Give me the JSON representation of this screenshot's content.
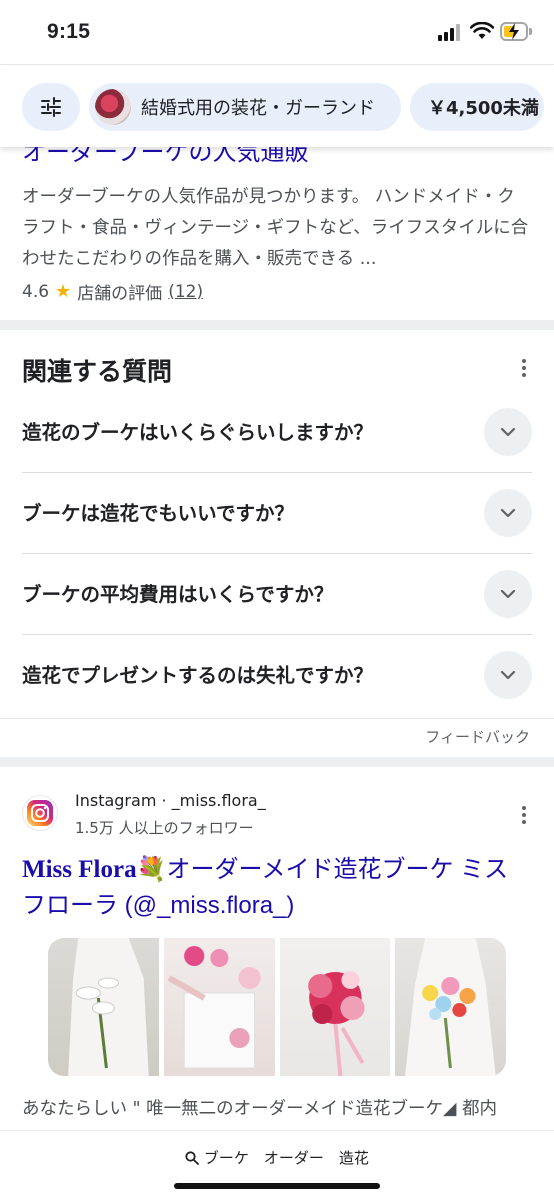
{
  "status_bar": {
    "time": "9:15"
  },
  "filter_chips": [
    {
      "label": ""
    },
    {
      "label": "結婚式用の装花・ガーランド"
    },
    {
      "label": "￥4,500未満"
    }
  ],
  "prev_result": {
    "title": "オーダーブーケの人気通販",
    "snippet": "オーダーブーケの人気作品が見つかります。 ハンドメイド・クラフト・食品・ヴィンテージ・ギフトなど、ライフスタイルに合わせたこだわりの作品を購入・販売できる ...",
    "rating_value": "4.6",
    "rating_label": "店舗の評価",
    "rating_count": "(12)"
  },
  "paa": {
    "heading": "関連する質問",
    "questions": [
      "造花のブーケはいくらぐらいしますか？",
      "ブーケは造花でもいいですか？",
      "ブーケの平均費用はいくらですか？",
      "造花でプレゼントするのは失礼ですか？"
    ],
    "feedback": "フィードバック"
  },
  "instagram_result": {
    "source": "Instagram · _miss.flora_",
    "followers": "1.5万 人以上のフォロワー",
    "title_brand": "Miss Flora",
    "title_rest": "💐オーダーメイド造花ブーケ ミスフローラ (@_miss.flora_)",
    "description": "あなたらしい \" 唯一無二のオーダーメイド造花ブーケ◢ 都内"
  },
  "bottom_search": {
    "query": "ブーケ　オーダー　造花"
  },
  "colors": {
    "link": "#1a0dab",
    "chip_bg": "#e8effa",
    "star": "#f5b400"
  }
}
